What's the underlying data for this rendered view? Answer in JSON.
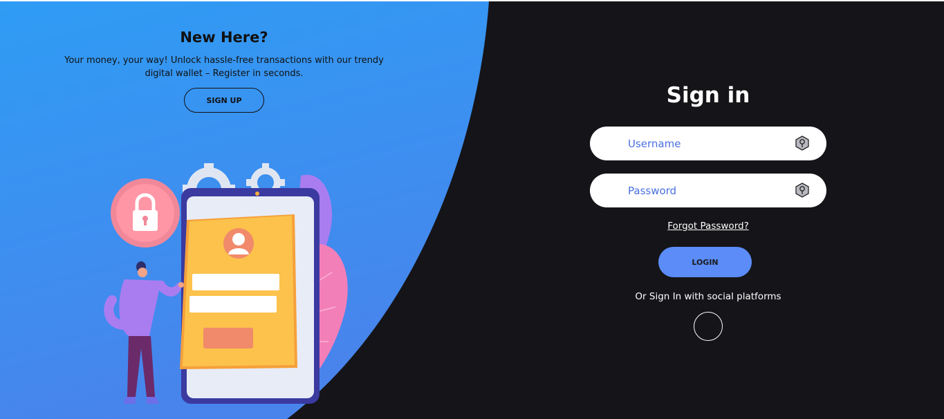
{
  "left": {
    "title": "New Here?",
    "description": "Your money, your way!  Unlock hassle-free transactions with our trendy digital wallet – Register in seconds.",
    "signup_label": "SIGN UP"
  },
  "signin": {
    "title": "Sign in",
    "username_placeholder": "Username",
    "password_placeholder": "Password",
    "forgot_label": "Forgot Password?",
    "login_label": "LOGIN",
    "social_text": "Or Sign In with social platforms"
  },
  "colors": {
    "gradient_top": "#2f98f2",
    "gradient_bottom": "#4a86ec",
    "dark_bg": "#151418",
    "accent_button": "#5b8cf8",
    "placeholder_text": "#4a6fe0"
  },
  "icons": {
    "field_icon": "key-icon",
    "illustration_lock": "padlock-icon",
    "illustration_user": "user-avatar-icon",
    "illustration_gears": "gear-icon"
  }
}
